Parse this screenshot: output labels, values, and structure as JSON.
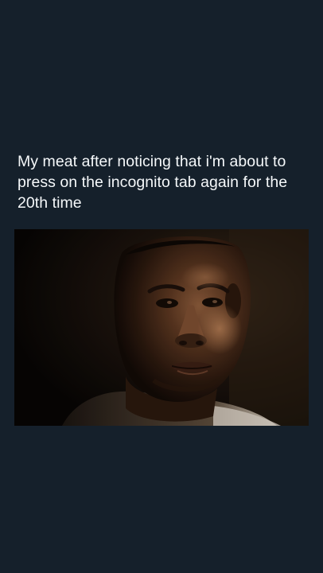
{
  "post": {
    "caption": "My meat after noticing that i'm about to\npress on the incognito tab again for the\n20th time",
    "image_subject": "meme-reaction-image"
  },
  "colors": {
    "background": "#15202b",
    "caption_text": "#f5f8fa"
  }
}
